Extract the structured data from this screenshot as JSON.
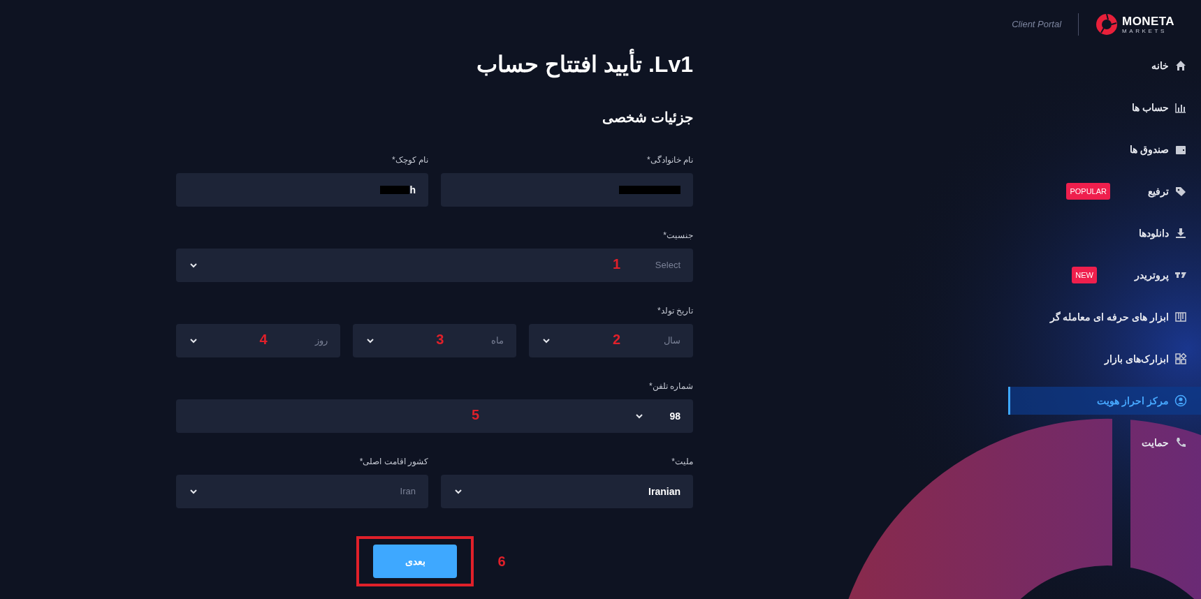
{
  "header": {
    "portal_label": "Client Portal",
    "logo": {
      "name": "MONETA",
      "sub": "MARKETS"
    }
  },
  "sidebar": {
    "items": [
      {
        "label": "خانه",
        "selected": false
      },
      {
        "label": "حساب ها",
        "selected": false
      },
      {
        "label": "صندوق ها",
        "selected": false
      },
      {
        "label": "ترفیع",
        "selected": false,
        "badge": "POPULAR"
      },
      {
        "label": "دانلودها",
        "selected": false
      },
      {
        "label": "پروتریدر",
        "selected": false,
        "badge": "NEW"
      },
      {
        "label": "ابزار های حرفه ای معامله گر",
        "selected": false
      },
      {
        "label": "ابزارک‌های بازار",
        "selected": false
      },
      {
        "label": "مرکز احراز هویت",
        "selected": true
      },
      {
        "label": "حمایت",
        "selected": false
      }
    ]
  },
  "title": "Lv1. تأیید افتتاح حساب",
  "section_title": "جزئیات شخصی",
  "rows": [
    {
      "fields": [
        {
          "label": "نام خانوادگی*",
          "kind": "text",
          "redacted": true
        },
        {
          "label": "نام کوچک*",
          "kind": "text",
          "value": "h",
          "redacted": true
        }
      ]
    },
    {
      "fields": [
        {
          "label": "جنسیت*",
          "kind": "select",
          "placeholder": "Select",
          "annotation": "1"
        }
      ]
    },
    {
      "label": "تاریخ تولد*",
      "fields": [
        {
          "kind": "select",
          "placeholder": "سال",
          "annotation": "2"
        },
        {
          "kind": "select",
          "placeholder": "ماه",
          "annotation": "3"
        },
        {
          "kind": "select",
          "placeholder": "روز",
          "annotation": "4"
        }
      ]
    },
    {
      "fields": [
        {
          "label": "شماره تلفن*",
          "kind": "phone",
          "value": "98",
          "annotation": "5"
        }
      ]
    },
    {
      "fields": [
        {
          "label": "ملیت*",
          "kind": "select",
          "value": "Iranian"
        },
        {
          "label": "کشور اقامت اصلی*",
          "kind": "select",
          "placeholder": "Iran"
        }
      ]
    }
  ],
  "next_button": {
    "label": "بعدی",
    "annotation": "6"
  }
}
